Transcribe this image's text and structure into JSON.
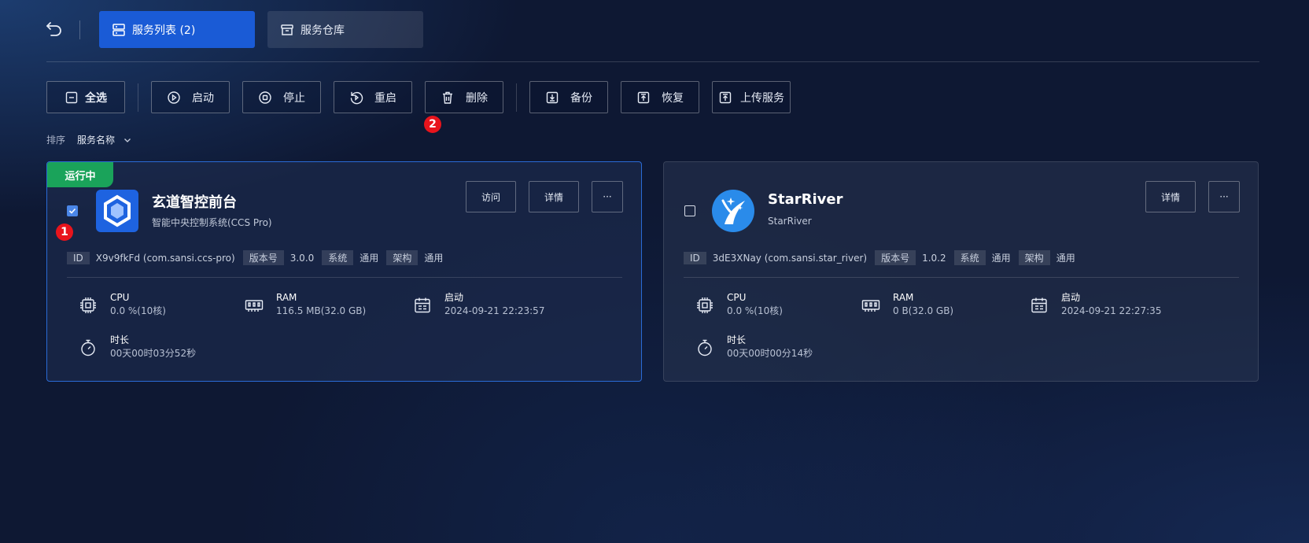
{
  "header": {
    "tabs": [
      {
        "label": "服务列表 (2)",
        "active": true
      },
      {
        "label": "服务仓库",
        "active": false
      }
    ]
  },
  "toolbar": {
    "select_all": "全选",
    "start": "启动",
    "stop": "停止",
    "restart": "重启",
    "delete": "删除",
    "backup": "备份",
    "restore": "恢复",
    "upload": "上传服务"
  },
  "annotations": {
    "badge_1": "1",
    "badge_2": "2"
  },
  "sort": {
    "label": "排序",
    "value": "服务名称"
  },
  "services": [
    {
      "status": "运行中",
      "checked": true,
      "title": "玄道智控前台",
      "subtitle": "智能中央控制系统(CCS Pro)",
      "actions": {
        "visit": "访问",
        "details": "详情",
        "more": "···"
      },
      "meta": {
        "id_key": "ID",
        "id_val": "X9v9fkFd (com.sansi.ccs-pro)",
        "ver_key": "版本号",
        "ver_val": "3.0.0",
        "sys_key": "系统",
        "sys_val": "通用",
        "arch_key": "架构",
        "arch_val": "通用"
      },
      "stats": {
        "cpu_label": "CPU",
        "cpu_value": "0.0 %(10核)",
        "ram_label": "RAM",
        "ram_value": "116.5 MB(32.0 GB)",
        "start_label": "启动",
        "start_value": "2024-09-21 22:23:57",
        "dur_label": "时长",
        "dur_value": "00天00时03分52秒"
      }
    },
    {
      "status": "",
      "checked": false,
      "title": "StarRiver",
      "subtitle": "StarRiver",
      "actions": {
        "details": "详情",
        "more": "···"
      },
      "meta": {
        "id_key": "ID",
        "id_val": "3dE3XNay (com.sansi.star_river)",
        "ver_key": "版本号",
        "ver_val": "1.0.2",
        "sys_key": "系统",
        "sys_val": "通用",
        "arch_key": "架构",
        "arch_val": "通用"
      },
      "stats": {
        "cpu_label": "CPU",
        "cpu_value": "0.0 %(10核)",
        "ram_label": "RAM",
        "ram_value": "0 B(32.0 GB)",
        "start_label": "启动",
        "start_value": "2024-09-21 22:27:35",
        "dur_label": "时长",
        "dur_value": "00天00时00分14秒"
      }
    }
  ],
  "colors": {
    "accent": "#1a5bd6",
    "running": "#1aa35a",
    "badge": "#e8141c"
  }
}
